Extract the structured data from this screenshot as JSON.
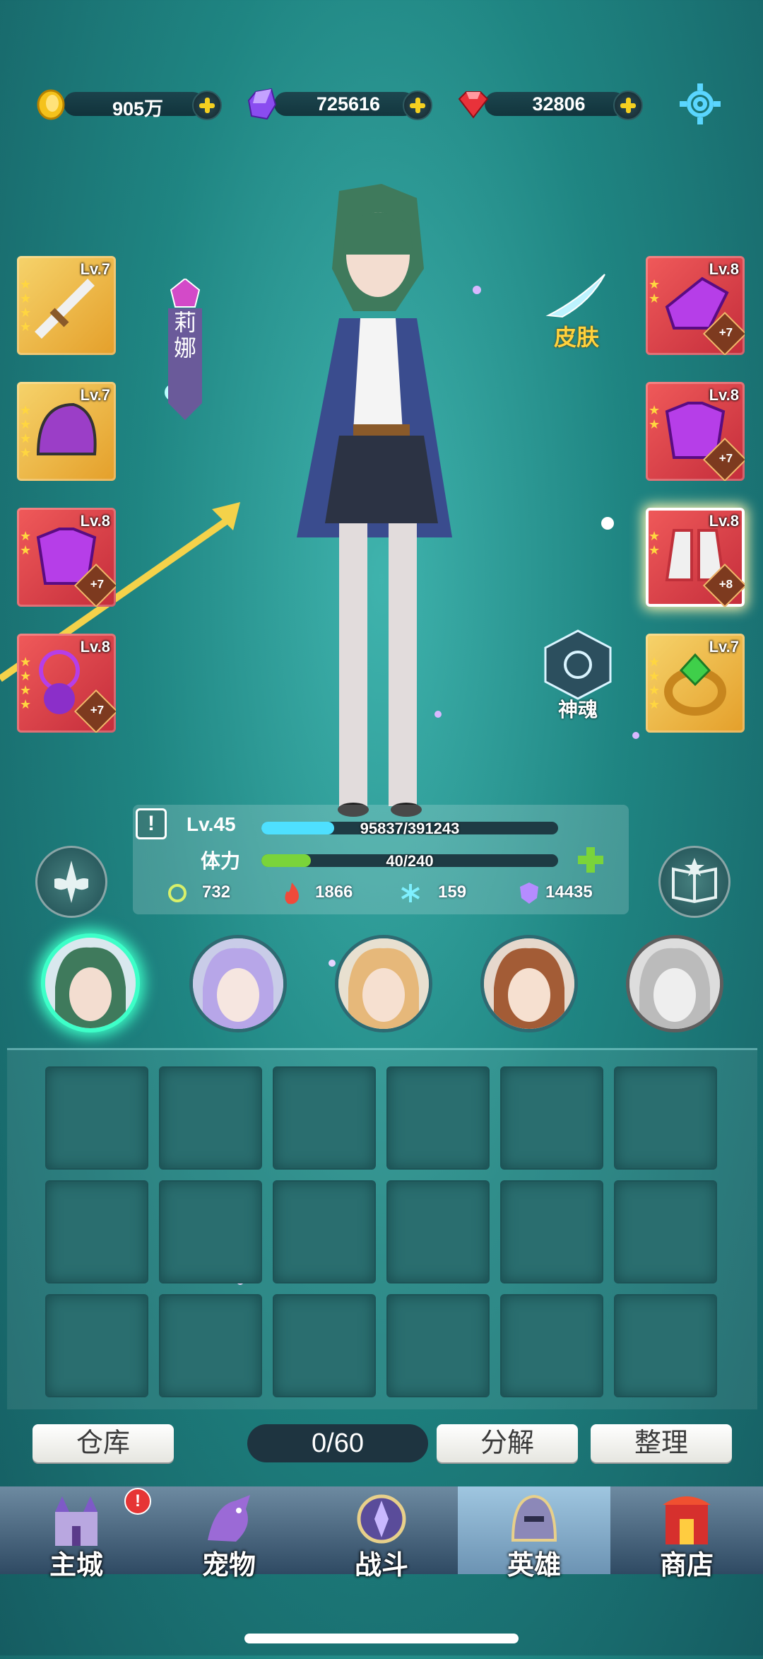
{
  "currencies": [
    {
      "name": "gold",
      "value": "905万",
      "color": "#f5c21b"
    },
    {
      "name": "crystal",
      "value": "725616",
      "color": "#8a4cf0"
    },
    {
      "name": "ruby",
      "value": "32806",
      "color": "#e8323a"
    }
  ],
  "hero_name": "莉娜",
  "skin_label": "皮肤",
  "soul_label": "神魂",
  "equipment_left": [
    {
      "level": "Lv.7",
      "item": "sword",
      "stars": 4,
      "plus": ""
    },
    {
      "level": "Lv.7",
      "item": "helmet",
      "stars": 4,
      "plus": ""
    },
    {
      "level": "Lv.8",
      "item": "armor",
      "stars": 2,
      "plus": "+7"
    },
    {
      "level": "Lv.8",
      "item": "amulet",
      "stars": 4,
      "plus": "+7"
    }
  ],
  "equipment_right": [
    {
      "level": "Lv.8",
      "item": "gauntlet",
      "stars": 2,
      "plus": "+7"
    },
    {
      "level": "Lv.8",
      "item": "chest-armor",
      "stars": 2,
      "plus": "+7"
    },
    {
      "level": "Lv.8",
      "item": "boots",
      "stars": 2,
      "plus": "+8"
    },
    {
      "level": "Lv.7",
      "item": "ring",
      "stars": 4,
      "plus": ""
    }
  ],
  "stats": {
    "level": "Lv.45",
    "exp_text": "95837/391243",
    "exp_fraction": 0.245,
    "stamina_label": "体力",
    "stamina_text": "40/240",
    "stamina_fraction": 0.167,
    "attack": "732",
    "fire": "1866",
    "ice": "159",
    "defense": "14435"
  },
  "inventory": {
    "count": "0/60",
    "rows": 3,
    "cols": 6
  },
  "actions": {
    "warehouse": "仓库",
    "decompose": "分解",
    "arrange": "整理"
  },
  "tabs": [
    {
      "label": "主城",
      "badge": "!"
    },
    {
      "label": "宠物"
    },
    {
      "label": "战斗"
    },
    {
      "label": "英雄",
      "active": true
    },
    {
      "label": "商店"
    }
  ]
}
